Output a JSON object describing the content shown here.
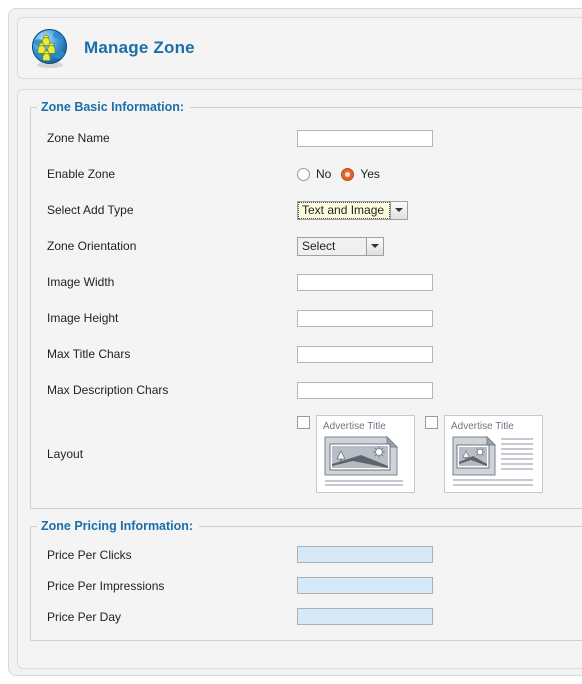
{
  "header": {
    "icon": "globe-users-icon",
    "title": "Manage Zone"
  },
  "sections": [
    {
      "legend": "Zone Basic Information:",
      "rows": [
        {
          "label": "Zone Name",
          "control": "text",
          "value": ""
        },
        {
          "label": "Enable Zone",
          "control": "radio",
          "options": [
            "No",
            "Yes"
          ],
          "selected": "Yes"
        },
        {
          "label": "Select Add Type",
          "control": "select",
          "value": "Text and Image",
          "focused": true
        },
        {
          "label": "Zone Orientation",
          "control": "select",
          "value": "Select",
          "focused": false
        },
        {
          "label": "Image Width",
          "control": "text",
          "value": ""
        },
        {
          "label": "Image Height",
          "control": "text",
          "value": ""
        },
        {
          "label": "Max Title Chars",
          "control": "text",
          "value": ""
        },
        {
          "label": "Max Description Chars",
          "control": "text",
          "value": ""
        },
        {
          "label": "Layout",
          "control": "layout"
        }
      ]
    },
    {
      "legend": "Zone Pricing Information:",
      "rows": [
        {
          "label": "Price Per Clicks",
          "control": "text-priced",
          "value": ""
        },
        {
          "label": "Price Per Impressions",
          "control": "text-priced",
          "value": ""
        },
        {
          "label": "Price Per Day",
          "control": "text-priced",
          "value": ""
        }
      ]
    }
  ],
  "layout_options": [
    {
      "name": "layout-image-top",
      "thumb_title": "Advertise Title",
      "checked": false
    },
    {
      "name": "layout-image-left",
      "thumb_title": "Advertise Title",
      "checked": false
    }
  ],
  "colors": {
    "accent_blue": "#1a6fa8",
    "radio_selected": "#e8632a",
    "priced_input_bg": "#d5e9f9",
    "panel_bg": "#f4f4f4",
    "page_bg": "#f2f2f2"
  }
}
